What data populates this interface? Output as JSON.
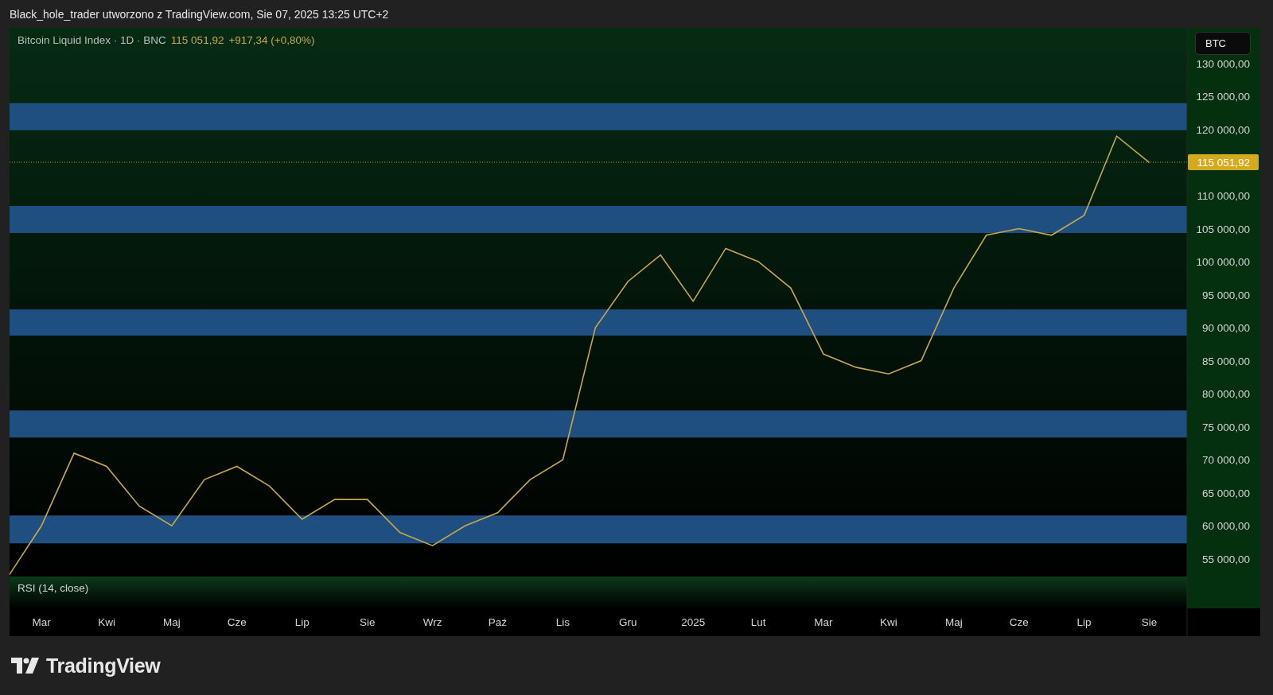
{
  "header": {
    "text": "Black_hole_trader utworzono z TradingView.com, Sie 07, 2025 13:25 UTC+2"
  },
  "legend": {
    "symbol": "Bitcoin Liquid Index · 1D · BNC",
    "price": "115 051,92",
    "change": "+917,34 (+0,80%)"
  },
  "currency": "BTC",
  "chart_data": {
    "type": "line",
    "categories": [
      null,
      "Mar",
      null,
      "Kwi",
      null,
      "Maj",
      null,
      "Cze",
      null,
      "Lip",
      null,
      "Sie",
      null,
      "Wrz",
      null,
      "Paź",
      null,
      "Lis",
      null,
      "Gru",
      null,
      "2025",
      null,
      "Lut",
      null,
      "Mar",
      null,
      "Kwi",
      null,
      "Maj",
      null,
      "Cze",
      null,
      "Lip",
      null,
      "Sie"
    ],
    "series": [
      {
        "color": "#c8a84b",
        "values": [
          52500,
          60000,
          71000,
          69000,
          63000,
          60000,
          67000,
          69000,
          66000,
          61000,
          64000,
          64000,
          59000,
          57000,
          60000,
          62000,
          67000,
          70000,
          90000,
          97000,
          101000,
          94000,
          102000,
          100000,
          96000,
          86000,
          84000,
          83000,
          85000,
          96000,
          104000,
          105000,
          104000,
          107000,
          119000,
          115000
        ]
      }
    ],
    "ylim": [
      43300,
      135400
    ],
    "yticks": [
      {
        "value": 55000,
        "label": "55 000,00"
      },
      {
        "value": 60000,
        "label": "60 000,00"
      },
      {
        "value": 65000,
        "label": "65 000,00"
      },
      {
        "value": 70000,
        "label": "70 000,00"
      },
      {
        "value": 75000,
        "label": "75 000,00"
      },
      {
        "value": 80000,
        "label": "80 000,00"
      },
      {
        "value": 85000,
        "label": "85 000,00"
      },
      {
        "value": 90000,
        "label": "90 000,00"
      },
      {
        "value": 95000,
        "label": "95 000,00"
      },
      {
        "value": 100000,
        "label": "100 000,00"
      },
      {
        "value": 105000,
        "label": "105 000,00"
      },
      {
        "value": 110000,
        "label": "110 000,00"
      },
      {
        "value": 120000,
        "label": "120 000,00"
      },
      {
        "value": 125000,
        "label": "125 000,00"
      },
      {
        "value": 130000,
        "label": "130 000,00"
      }
    ],
    "bands": [
      {
        "axis": "y",
        "from": 119900,
        "to": 124000
      },
      {
        "axis": "y",
        "from": 104340,
        "to": 108430
      },
      {
        "axis": "y",
        "from": 88800,
        "to": 92770
      },
      {
        "axis": "y",
        "from": 73370,
        "to": 77470
      },
      {
        "axis": "y",
        "from": 57350,
        "to": 61570
      }
    ],
    "ref_lines": [
      {
        "axis": "y",
        "value": 115051.92,
        "label": "115 051,92"
      }
    ]
  },
  "rsi": {
    "label": "RSI (14, close)"
  },
  "footer": {
    "brand": "TradingView"
  }
}
